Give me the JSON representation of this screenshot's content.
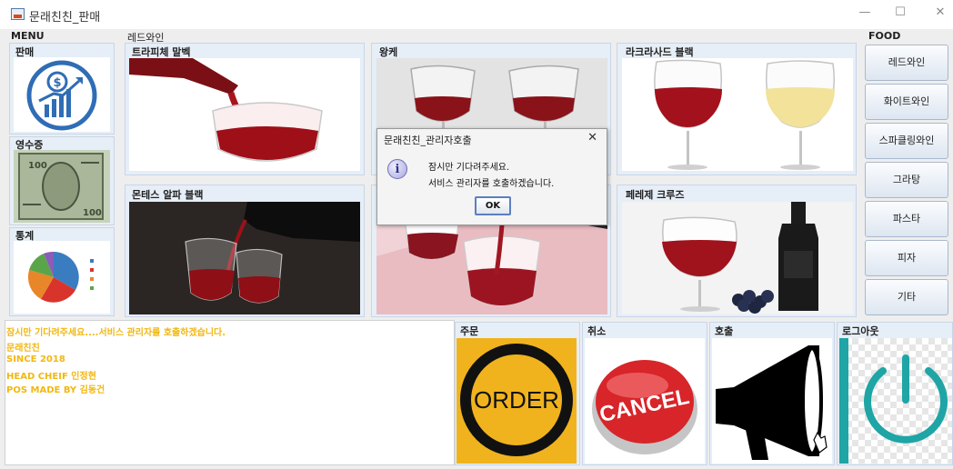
{
  "window": {
    "title": "문래친친_판매",
    "minimize": "—",
    "maximize": "☐",
    "close": "✕"
  },
  "menu": {
    "title": "MENU",
    "items": [
      {
        "label": "판매",
        "icon": "sales-dollar-chart-icon"
      },
      {
        "label": "영수증",
        "icon": "money-banknote-icon"
      },
      {
        "label": "통계",
        "icon": "pie-chart-icon"
      }
    ]
  },
  "category": {
    "title": "레드와인",
    "wines": [
      {
        "label": "트라피체 말벡",
        "image": "wine-pouring-into-glass"
      },
      {
        "label": "왕케",
        "image": "two-wine-glasses"
      },
      {
        "label": "라크라사드 블랙",
        "image": "red-and-white-wine-glasses"
      },
      {
        "label": "몬테스 알파 블랙",
        "image": "wine-bottle-pouring-two-glasses"
      },
      {
        "label": "",
        "image": "wine-pouring-pink-background"
      },
      {
        "label": "페레제 크루즈",
        "image": "wine-glass-bottle-grapes"
      }
    ]
  },
  "food": {
    "title": "FOOD",
    "buttons": [
      "레드와인",
      "화이트와인",
      "스파클링와인",
      "그라탕",
      "파스타",
      "피자",
      "기타"
    ]
  },
  "log": {
    "lines": [
      "잠시만 기다려주세요....서비스 관리자를 호출하겠습니다.",
      "문래친친",
      "SINCE 2018",
      "HEAD CHEIF 인정현",
      "POS MADE BY 김동건"
    ],
    "color": "#f2b70f"
  },
  "actions": [
    {
      "label": "주문",
      "text": "ORDER",
      "icon": "order-circle-icon"
    },
    {
      "label": "취소",
      "text": "CANCEL",
      "icon": "cancel-button-icon"
    },
    {
      "label": "호출",
      "text": "",
      "icon": "megaphone-icon"
    },
    {
      "label": "로그아웃",
      "text": "",
      "icon": "power-icon"
    }
  ],
  "dialog": {
    "title": "문래친친_관리자호출",
    "close": "✕",
    "icon": "info-icon",
    "icon_glyph": "i",
    "line1": "잠시만 기다려주세요.",
    "line2": "서비스 관리자를 호출하겠습니다.",
    "ok": "OK"
  },
  "colors": {
    "panel_bg": "#e6eef7",
    "accent_blue": "#2f6db5",
    "order_yellow": "#f0b31e",
    "cancel_red": "#d8252a",
    "power_teal": "#1fa5a5"
  }
}
